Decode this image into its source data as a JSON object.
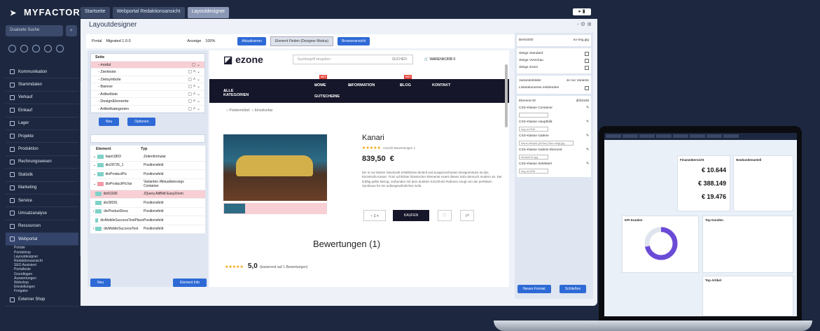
{
  "app": {
    "brand": "MYFACTORY"
  },
  "tabs": [
    "Startseite",
    "Webportal Redaktionsansicht",
    "Layoutdesigner"
  ],
  "sidebar": {
    "search_placeholder": "Dualsete Suche",
    "items": [
      "Kommunikation",
      "Stammdaten",
      "Verkauf",
      "Einkauf",
      "Lager",
      "Projekte",
      "Produktion",
      "Rechnungswesen",
      "Statistik",
      "Marketing",
      "Service",
      "Umsatzanalyse",
      "Ressourcen",
      "Webportal"
    ],
    "subitems": [
      "Portale",
      "Portalshop",
      "Layoutdesigner",
      "Redaktionsansicht",
      "SEO Assistent",
      "Portalfeste",
      "Grundlagen",
      "Auswertungen",
      "Webshop",
      "Einstellungen",
      "Freigabe"
    ],
    "bottom_item": "Externer Shop"
  },
  "window": {
    "title": "Layoutdesigner",
    "toolbar": {
      "portal_label": "Portal",
      "portal_value": "Migrated 1.0.0",
      "view_label": "Anzeige",
      "zoom_value": "100%",
      "refresh_button": "Aktualisieren",
      "find_element_button": "Element Finden (Designer Modus)",
      "browser_button": "Browseransicht"
    },
    "left_panel": {
      "tree_header": "Seite",
      "tree_items": [
        "- modul",
        "- Zierleiste",
        "- Zielsymbole",
        "- Banner",
        "- Artikelliste",
        "- DesignElemente",
        "- Artikelkategorien"
      ],
      "new_button": "Neu",
      "options_button": "Optionen",
      "col_element": "Element",
      "col_type": "Typ",
      "rows": [
        {
          "element": "faant1803",
          "type": "Zeilenformular"
        },
        {
          "element": "div29726_1",
          "type": "Positionsfeld"
        },
        {
          "element": "divProductPic",
          "type": "Positionsfeld"
        },
        {
          "element": "divProductPicVar",
          "type": "Varianten /Aktualisierungs Container"
        },
        {
          "element": "div51166",
          "type": "JQuery.AttBild EasyZoom"
        },
        {
          "element": "div38291",
          "type": "Positionsfeld"
        },
        {
          "element": "divProductDesc",
          "type": "Positionsfeld"
        },
        {
          "element": "divMobileSuccessTextPlace",
          "type": "Positionsfeld"
        },
        {
          "element": "divMobileSuccessText",
          "type": "Positionsfeld"
        }
      ],
      "bottom_new": "Neu",
      "bottom_element": "Element Info"
    },
    "site": {
      "logo": "ezone",
      "search_placeholder": "Suchbegriff eingeben",
      "search_button": "SUCHEN",
      "cart_label": "WARENKORB",
      "cart_count": "0",
      "nav_all": "ALLE KATEGORIEN",
      "nav_items": [
        "HOME",
        "INFORMATION",
        "BLOG",
        "KONTAKT"
      ],
      "nav_voucher": "GUTSCHEINE",
      "hot_badge": "HOT",
      "filters": [
        "Polstermöbel",
        "Einzelsofas"
      ],
      "product_name": "Kanari",
      "review_label": "Ansicht Bewertungen 1",
      "price": "839,50",
      "currency": "€",
      "description": "Ein in nur kleiner Stückzahl erhältliches Modell und ausgezeichnetes Designerstück ist das Einzelsofa Kanari. Trotz schlichter klassischer Elemente mutet dieses Sofa dennoch modern an. Der kräftig gelbe Bezug, verbunden mit dem dunklen Kirschholz-Rahmen zeugt von der perfekten Symbiose für ein außergewöhnliches Sofa.",
      "qty": "1",
      "buy_button": "KAUFEN",
      "reviews_title": "Bewertungen (1)",
      "rating_value": "5,0",
      "rating_note": "(basierend auf 1 Bewertungen)"
    },
    "right_panel": {
      "breakpoint_label": "Breit1000",
      "image_label": "no-img.jpg",
      "rows": [
        "Steige Standard",
        "Steige Vorschau",
        "Steige Zoom"
      ],
      "variants_label": "Variantenbilder",
      "variants_value": "Je nur Variante",
      "link_docs": "Linkdokumente einblenden",
      "element_id_label": "Element-ID",
      "element_id_value": "dif33108",
      "css_container": "CSS-Klasse Container",
      "css_main": "CSS-Klasse Hauptbild",
      "css_main_value": "img-m1908",
      "css_gallery": "CSS-Klasse Galerie",
      "css_gallery_value": "fokus-imbyild (id-Bsc) Bsc-mbgl.jpg",
      "css_gallery_element": "CSS-Klasse Galerie Element",
      "css_gallery_element_value": "divtable-B jpg",
      "css_selection": "CSS-Klasse Selektiert",
      "css_selection_value": "img-m1908",
      "new_format": "Neues Format",
      "close_button": "Schließen"
    }
  },
  "laptop": {
    "card_titles": [
      "Finanzübersicht",
      "Neukundenanteil",
      "KPI Kunden",
      "Top Kunden",
      "Top Artikel"
    ],
    "kpis": [
      "€ 10.644",
      "€ 388.149",
      "€ 19.476"
    ]
  }
}
